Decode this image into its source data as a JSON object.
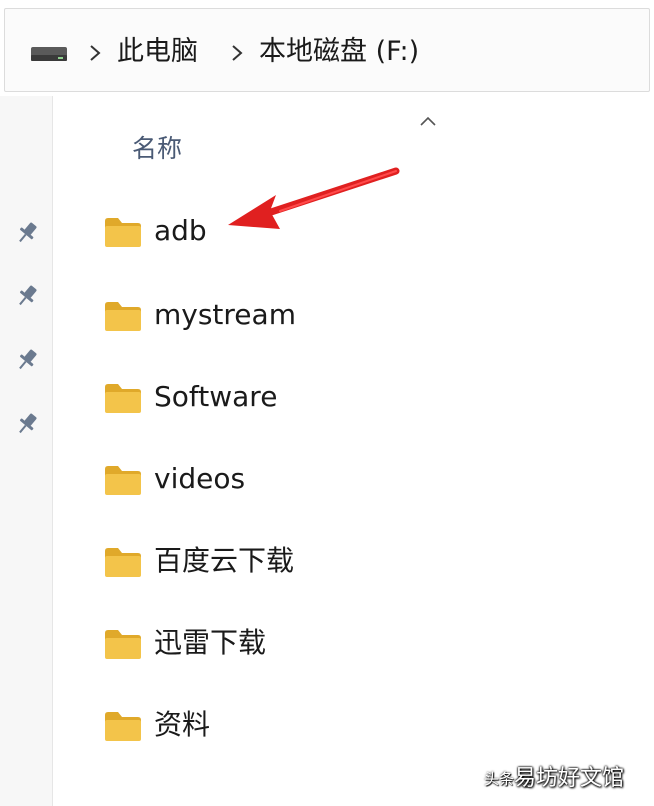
{
  "breadcrumb": {
    "items": [
      "此电脑",
      "本地磁盘 (F:)"
    ],
    "drive_icon": "drive-icon",
    "separator_icon": "chevron-right-icon"
  },
  "header": {
    "column_name": "名称",
    "sort_icon": "chevron-up-icon"
  },
  "quick_access": {
    "pins": [
      "pin-icon",
      "pin-icon",
      "pin-icon",
      "pin-icon"
    ]
  },
  "files": [
    {
      "name": "adb",
      "icon": "folder-icon"
    },
    {
      "name": "mystream",
      "icon": "folder-icon"
    },
    {
      "name": "Software",
      "icon": "folder-icon"
    },
    {
      "name": "videos",
      "icon": "folder-icon"
    },
    {
      "name": "百度云下载",
      "icon": "folder-icon"
    },
    {
      "name": "迅雷下载",
      "icon": "folder-icon"
    },
    {
      "name": "资料",
      "icon": "folder-icon"
    }
  ],
  "annotation": {
    "icon": "red-arrow-icon",
    "color": "#e02020"
  },
  "watermark": {
    "prefix": "头条 @",
    "text": "易坊好文馆"
  },
  "colors": {
    "folder": "#f3c44a",
    "folder_dark": "#e0a92a",
    "header_text": "#4a5a75"
  }
}
